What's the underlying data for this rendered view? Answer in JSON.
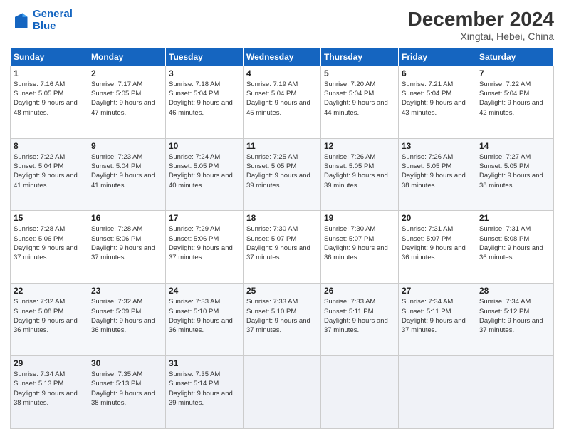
{
  "header": {
    "logo_line1": "General",
    "logo_line2": "Blue",
    "month": "December 2024",
    "location": "Xingtai, Hebei, China"
  },
  "weekdays": [
    "Sunday",
    "Monday",
    "Tuesday",
    "Wednesday",
    "Thursday",
    "Friday",
    "Saturday"
  ],
  "weeks": [
    [
      {
        "day": "1",
        "sunrise": "7:16 AM",
        "sunset": "5:05 PM",
        "daylight": "9 hours and 48 minutes."
      },
      {
        "day": "2",
        "sunrise": "7:17 AM",
        "sunset": "5:05 PM",
        "daylight": "9 hours and 47 minutes."
      },
      {
        "day": "3",
        "sunrise": "7:18 AM",
        "sunset": "5:04 PM",
        "daylight": "9 hours and 46 minutes."
      },
      {
        "day": "4",
        "sunrise": "7:19 AM",
        "sunset": "5:04 PM",
        "daylight": "9 hours and 45 minutes."
      },
      {
        "day": "5",
        "sunrise": "7:20 AM",
        "sunset": "5:04 PM",
        "daylight": "9 hours and 44 minutes."
      },
      {
        "day": "6",
        "sunrise": "7:21 AM",
        "sunset": "5:04 PM",
        "daylight": "9 hours and 43 minutes."
      },
      {
        "day": "7",
        "sunrise": "7:22 AM",
        "sunset": "5:04 PM",
        "daylight": "9 hours and 42 minutes."
      }
    ],
    [
      {
        "day": "8",
        "sunrise": "7:22 AM",
        "sunset": "5:04 PM",
        "daylight": "9 hours and 41 minutes."
      },
      {
        "day": "9",
        "sunrise": "7:23 AM",
        "sunset": "5:04 PM",
        "daylight": "9 hours and 41 minutes."
      },
      {
        "day": "10",
        "sunrise": "7:24 AM",
        "sunset": "5:05 PM",
        "daylight": "9 hours and 40 minutes."
      },
      {
        "day": "11",
        "sunrise": "7:25 AM",
        "sunset": "5:05 PM",
        "daylight": "9 hours and 39 minutes."
      },
      {
        "day": "12",
        "sunrise": "7:26 AM",
        "sunset": "5:05 PM",
        "daylight": "9 hours and 39 minutes."
      },
      {
        "day": "13",
        "sunrise": "7:26 AM",
        "sunset": "5:05 PM",
        "daylight": "9 hours and 38 minutes."
      },
      {
        "day": "14",
        "sunrise": "7:27 AM",
        "sunset": "5:05 PM",
        "daylight": "9 hours and 38 minutes."
      }
    ],
    [
      {
        "day": "15",
        "sunrise": "7:28 AM",
        "sunset": "5:06 PM",
        "daylight": "9 hours and 37 minutes."
      },
      {
        "day": "16",
        "sunrise": "7:28 AM",
        "sunset": "5:06 PM",
        "daylight": "9 hours and 37 minutes."
      },
      {
        "day": "17",
        "sunrise": "7:29 AM",
        "sunset": "5:06 PM",
        "daylight": "9 hours and 37 minutes."
      },
      {
        "day": "18",
        "sunrise": "7:30 AM",
        "sunset": "5:07 PM",
        "daylight": "9 hours and 37 minutes."
      },
      {
        "day": "19",
        "sunrise": "7:30 AM",
        "sunset": "5:07 PM",
        "daylight": "9 hours and 36 minutes."
      },
      {
        "day": "20",
        "sunrise": "7:31 AM",
        "sunset": "5:07 PM",
        "daylight": "9 hours and 36 minutes."
      },
      {
        "day": "21",
        "sunrise": "7:31 AM",
        "sunset": "5:08 PM",
        "daylight": "9 hours and 36 minutes."
      }
    ],
    [
      {
        "day": "22",
        "sunrise": "7:32 AM",
        "sunset": "5:08 PM",
        "daylight": "9 hours and 36 minutes."
      },
      {
        "day": "23",
        "sunrise": "7:32 AM",
        "sunset": "5:09 PM",
        "daylight": "9 hours and 36 minutes."
      },
      {
        "day": "24",
        "sunrise": "7:33 AM",
        "sunset": "5:10 PM",
        "daylight": "9 hours and 36 minutes."
      },
      {
        "day": "25",
        "sunrise": "7:33 AM",
        "sunset": "5:10 PM",
        "daylight": "9 hours and 37 minutes."
      },
      {
        "day": "26",
        "sunrise": "7:33 AM",
        "sunset": "5:11 PM",
        "daylight": "9 hours and 37 minutes."
      },
      {
        "day": "27",
        "sunrise": "7:34 AM",
        "sunset": "5:11 PM",
        "daylight": "9 hours and 37 minutes."
      },
      {
        "day": "28",
        "sunrise": "7:34 AM",
        "sunset": "5:12 PM",
        "daylight": "9 hours and 37 minutes."
      }
    ],
    [
      {
        "day": "29",
        "sunrise": "7:34 AM",
        "sunset": "5:13 PM",
        "daylight": "9 hours and 38 minutes."
      },
      {
        "day": "30",
        "sunrise": "7:35 AM",
        "sunset": "5:13 PM",
        "daylight": "9 hours and 38 minutes."
      },
      {
        "day": "31",
        "sunrise": "7:35 AM",
        "sunset": "5:14 PM",
        "daylight": "9 hours and 39 minutes."
      },
      null,
      null,
      null,
      null
    ]
  ]
}
